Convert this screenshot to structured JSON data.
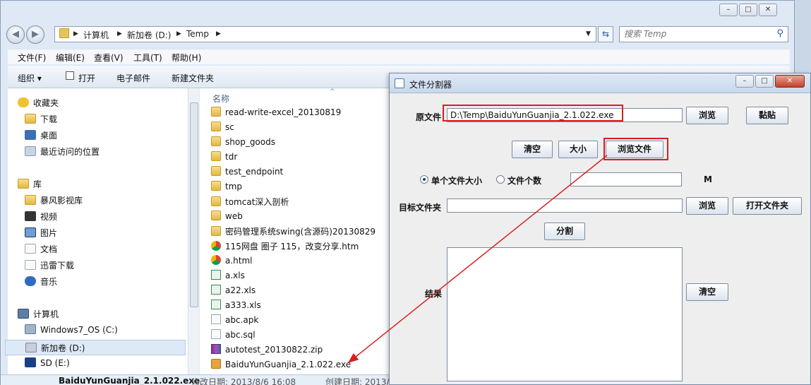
{
  "explorer": {
    "window_controls": [
      "–",
      "□",
      "✕"
    ],
    "breadcrumb": [
      "计算机",
      "新加卷 (D:)",
      "Temp"
    ],
    "search_placeholder": "搜索 Temp",
    "menu": [
      "文件(F)",
      "编辑(E)",
      "查看(V)",
      "工具(T)",
      "帮助(H)"
    ],
    "toolbar": {
      "organize": "组织 ▾",
      "open": "打开",
      "email": "电子邮件",
      "new_folder": "新建文件夹"
    },
    "nav": {
      "favorites": "收藏夹",
      "favorites_items": [
        "下载",
        "桌面",
        "最近访问的位置"
      ],
      "libraries": "库",
      "library_items": [
        "暴风影视库",
        "视频",
        "图片",
        "文档",
        "迅雷下载",
        "音乐"
      ],
      "computer": "计算机",
      "computer_items": [
        "Windows7_OS (C:)",
        "新加卷 (D:)",
        "SD (E:)"
      ]
    },
    "column_name": "名称",
    "files": [
      {
        "name": "read-write-excel_20130819",
        "icon": "folder"
      },
      {
        "name": "sc",
        "icon": "folder"
      },
      {
        "name": "shop_goods",
        "icon": "folder"
      },
      {
        "name": "tdr",
        "icon": "folder"
      },
      {
        "name": "test_endpoint",
        "icon": "folder"
      },
      {
        "name": "tmp",
        "icon": "folder"
      },
      {
        "name": "tomcat深入剖析",
        "icon": "folder"
      },
      {
        "name": "web",
        "icon": "folder"
      },
      {
        "name": "密码管理系统swing(含源码)20130829",
        "icon": "folder"
      },
      {
        "name": "115网盘 圈子 115，改变分享.htm",
        "icon": "chrome"
      },
      {
        "name": "a.html",
        "icon": "chrome"
      },
      {
        "name": "a.xls",
        "icon": "xls"
      },
      {
        "name": "a22.xls",
        "icon": "xls"
      },
      {
        "name": "a333.xls",
        "icon": "xls"
      },
      {
        "name": "abc.apk",
        "icon": "doc"
      },
      {
        "name": "abc.sql",
        "icon": "doc"
      },
      {
        "name": "autotest_20130822.zip",
        "icon": "zip"
      },
      {
        "name": "BaiduYunGuanjia_2.1.022.exe",
        "icon": "exe"
      }
    ],
    "details": {
      "name": "BaiduYunGuanjia_2.1.022.exe",
      "modified": "修改日期: 2013/8/6 16:08",
      "created": "创建日期: 2013/..."
    }
  },
  "splitter": {
    "title": "文件分割器",
    "controls": [
      "–",
      "□",
      "✕"
    ],
    "source_label": "原文件",
    "source_value": "D:\\Temp\\BaiduYunGuanjia_2.1.022.exe",
    "browse": "浏览",
    "paste": "黏贴",
    "clear": "清空",
    "size": "大小",
    "browse_file": "浏览文件",
    "radio_single_size": "单个文件大小",
    "radio_file_count": "文件个数",
    "unit": "M",
    "target_label": "目标文件夹",
    "target_browse": "浏览",
    "open_folder": "打开文件夹",
    "split": "分割",
    "result_label": "结果",
    "result_clear": "清空"
  }
}
